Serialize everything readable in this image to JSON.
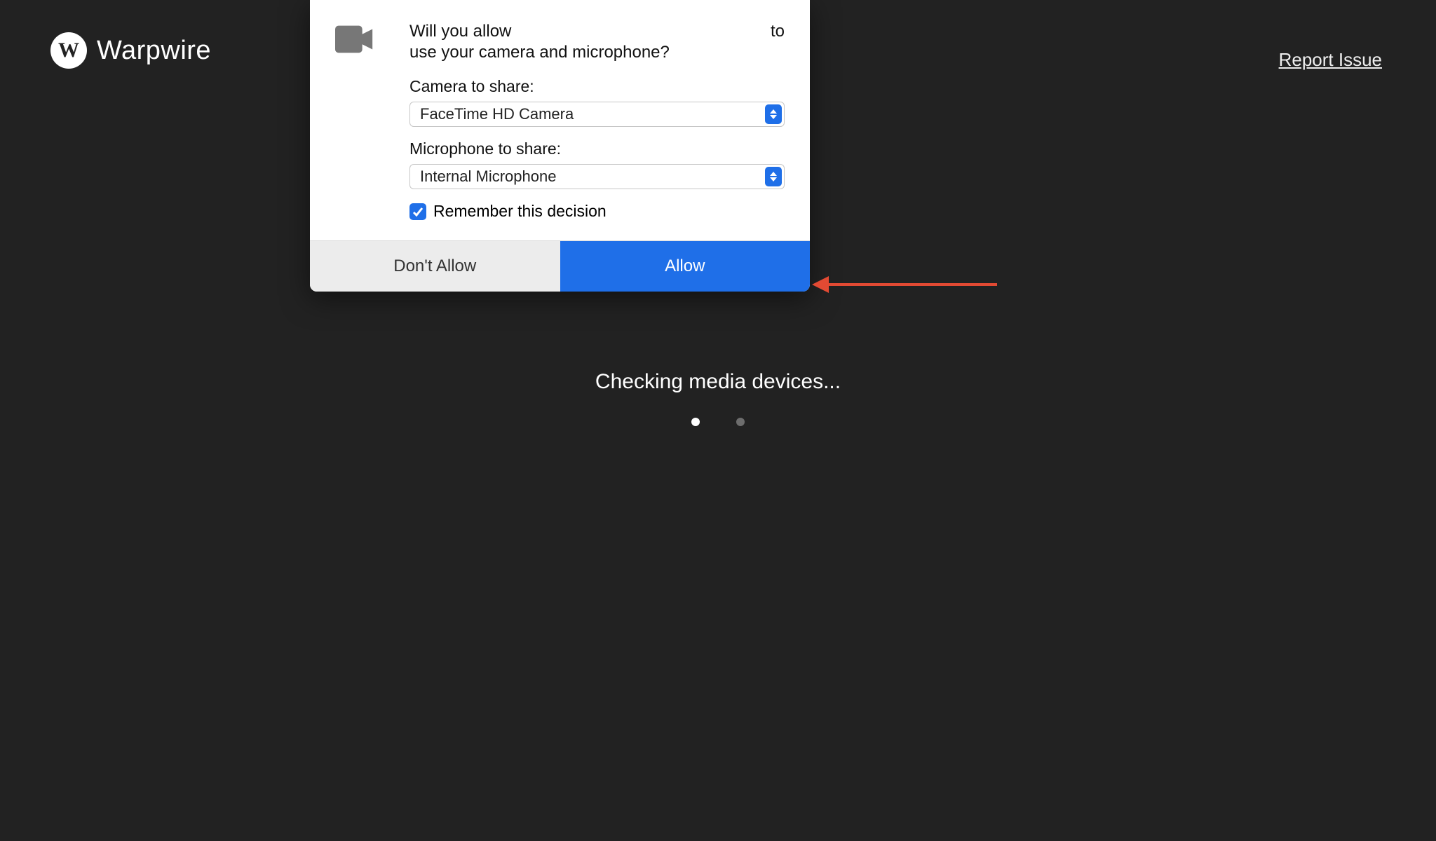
{
  "header": {
    "brand": "Warpwire",
    "logo_letter": "W"
  },
  "report_link": "Report Issue",
  "status_text": "Checking media devices...",
  "dialog": {
    "prompt_line1_left": "Will you allow",
    "prompt_line1_right": "to",
    "prompt_line2": "use your camera and microphone?",
    "camera_label": "Camera to share:",
    "camera_value": "FaceTime HD Camera",
    "mic_label": "Microphone to share:",
    "mic_value": "Internal Microphone",
    "remember_checked": true,
    "remember_label": "Remember this decision",
    "deny_label": "Don't Allow",
    "allow_label": "Allow"
  },
  "colors": {
    "accent": "#1f6fe8",
    "arrow": "#e24a33",
    "bg": "#222222"
  }
}
